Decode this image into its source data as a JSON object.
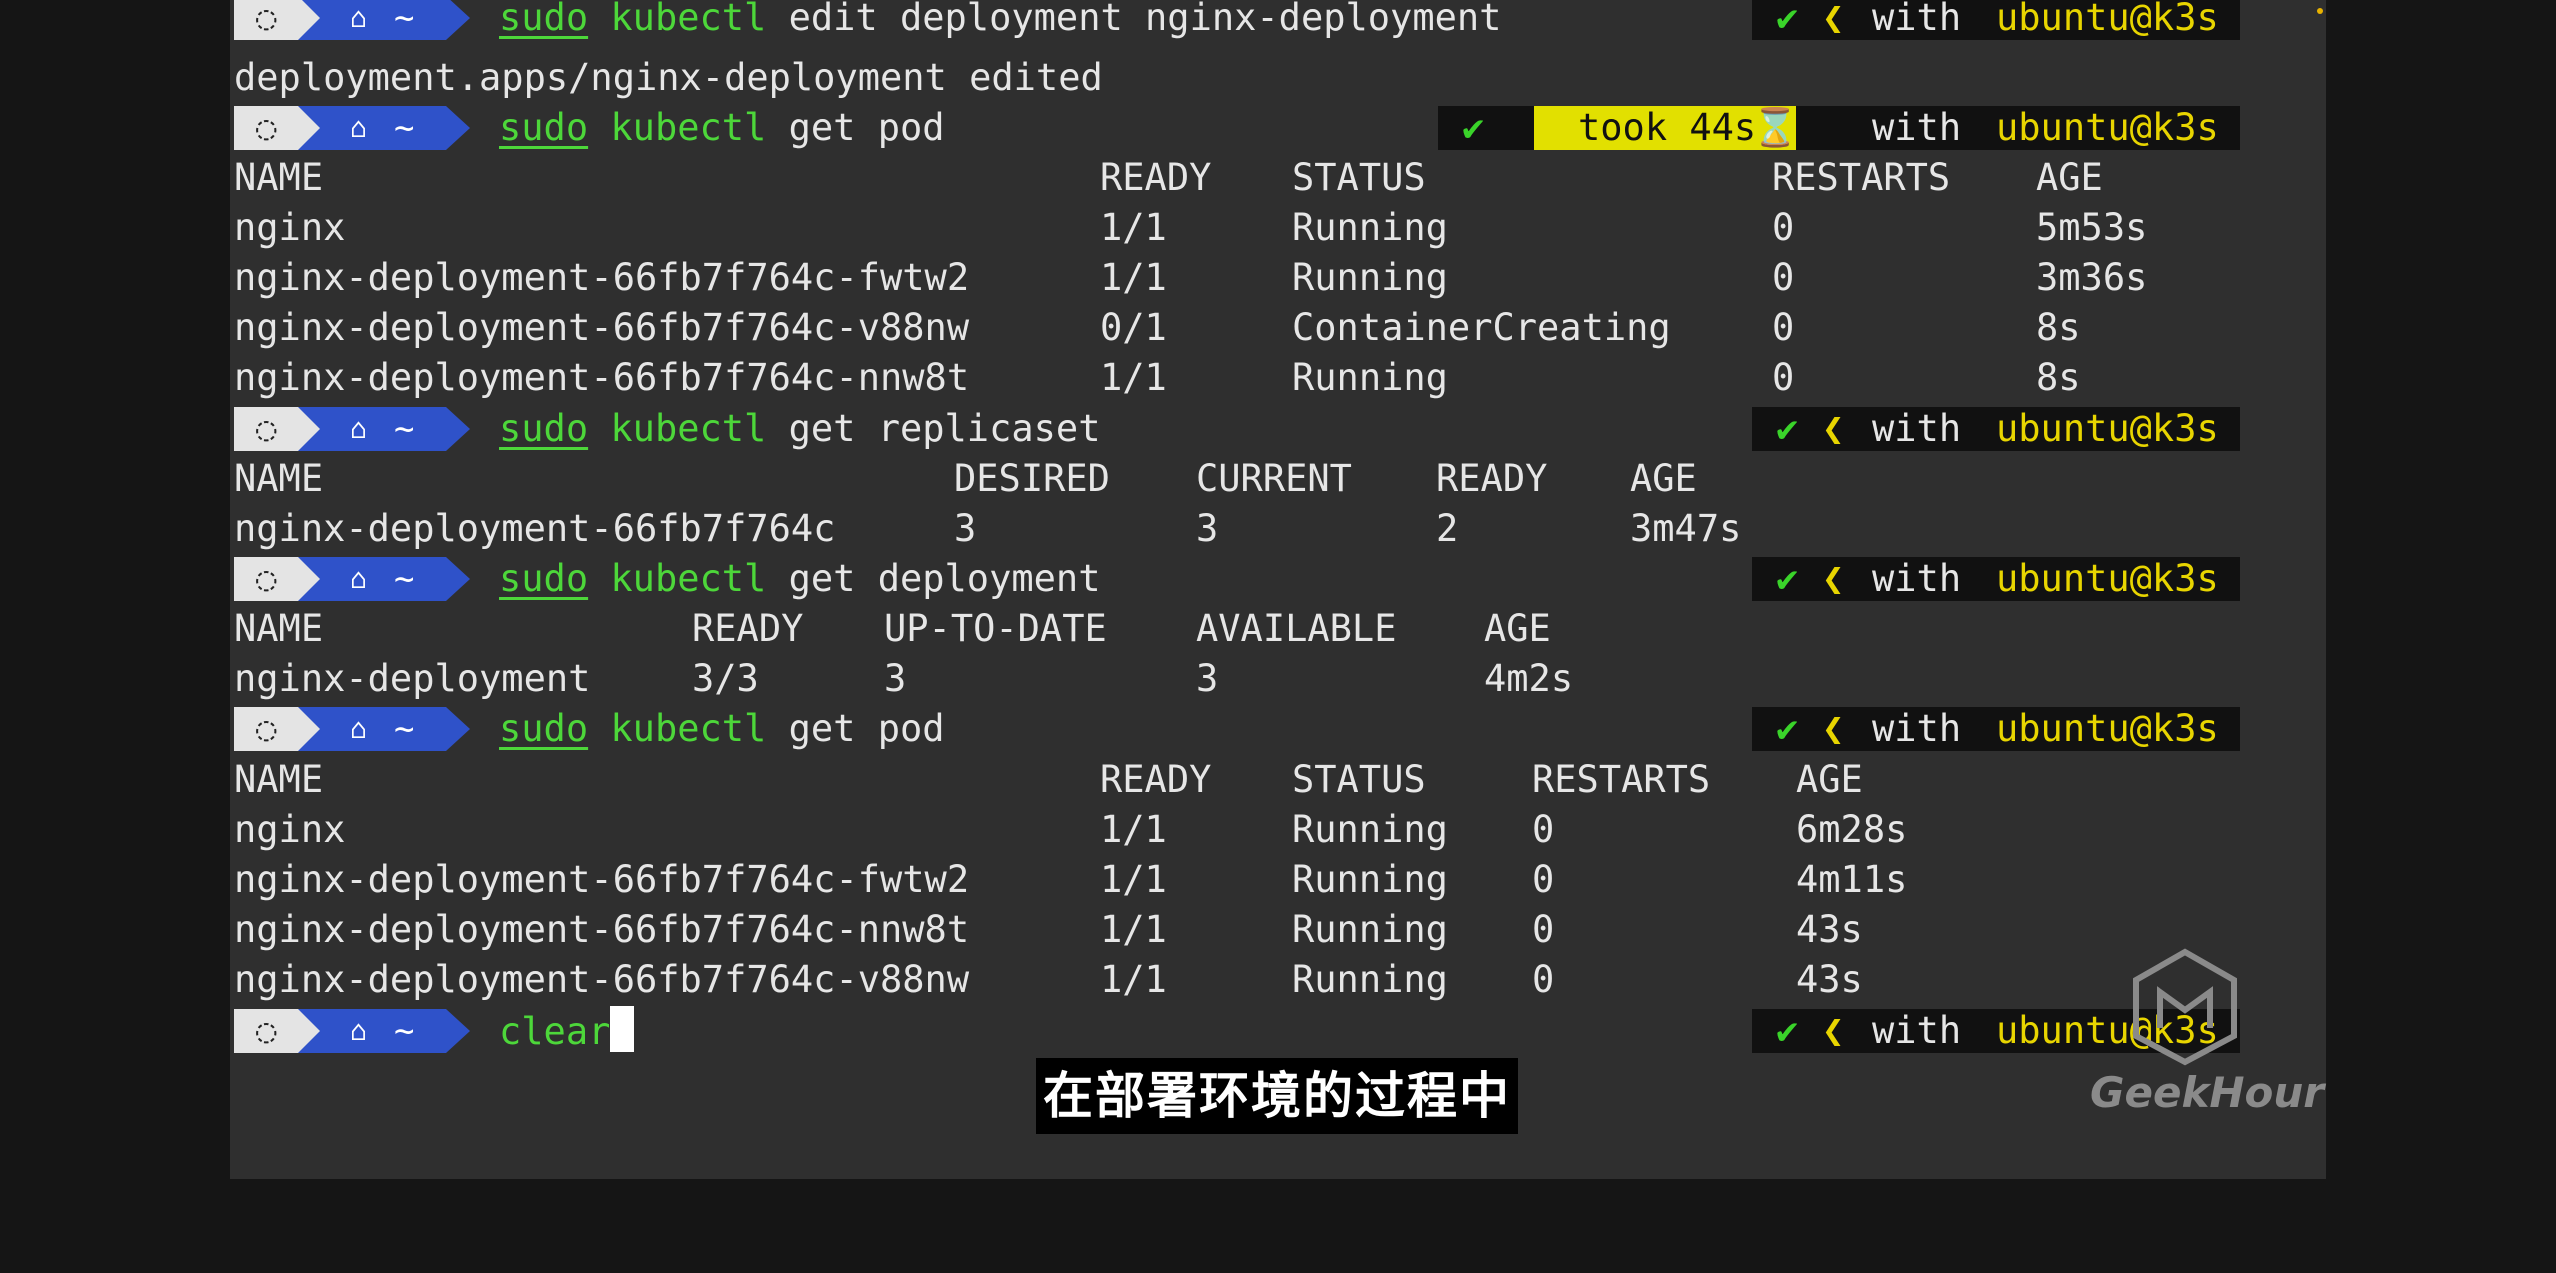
{
  "prompt": {
    "os_icon": "ubuntu-icon",
    "home_icon": "home-icon",
    "dir": "~"
  },
  "right_prompt": {
    "check": "✔",
    "sep": "❮",
    "with": "with",
    "userhost": "ubuntu@k3s",
    "took": "took 44s",
    "hourglass": "⌛"
  },
  "cmd1": {
    "sudo": "sudo",
    "kubectl": "kubectl",
    "rest": " edit deployment nginx-deployment"
  },
  "out1": "deployment.apps/nginx-deployment edited",
  "cmd2": {
    "sudo": "sudo",
    "kubectl": "kubectl",
    "rest": " get pod"
  },
  "pods1": {
    "headers": [
      "NAME",
      "READY",
      "STATUS",
      "RESTARTS",
      "AGE"
    ],
    "rows": [
      [
        "nginx",
        "1/1",
        "Running",
        "0",
        "5m53s"
      ],
      [
        "nginx-deployment-66fb7f764c-fwtw2",
        "1/1",
        "Running",
        "0",
        "3m36s"
      ],
      [
        "nginx-deployment-66fb7f764c-v88nw",
        "0/1",
        "ContainerCreating",
        "0",
        "8s"
      ],
      [
        "nginx-deployment-66fb7f764c-nnw8t",
        "1/1",
        "Running",
        "0",
        "8s"
      ]
    ]
  },
  "cmd3": {
    "sudo": "sudo",
    "kubectl": "kubectl",
    "rest": " get replicaset"
  },
  "rs": {
    "headers": [
      "NAME",
      "DESIRED",
      "CURRENT",
      "READY",
      "AGE"
    ],
    "rows": [
      [
        "nginx-deployment-66fb7f764c",
        "3",
        "3",
        "2",
        "3m47s"
      ]
    ]
  },
  "cmd4": {
    "sudo": "sudo",
    "kubectl": "kubectl",
    "rest": " get deployment"
  },
  "deploy": {
    "headers": [
      "NAME",
      "READY",
      "UP-TO-DATE",
      "AVAILABLE",
      "AGE"
    ],
    "rows": [
      [
        "nginx-deployment",
        "3/3",
        "3",
        "3",
        "4m2s"
      ]
    ]
  },
  "cmd5": {
    "sudo": "sudo",
    "kubectl": "kubectl",
    "rest": " get pod"
  },
  "pods2": {
    "headers": [
      "NAME",
      "READY",
      "STATUS",
      "RESTARTS",
      "AGE"
    ],
    "rows": [
      [
        "nginx",
        "1/1",
        "Running",
        "0",
        "6m28s"
      ],
      [
        "nginx-deployment-66fb7f764c-fwtw2",
        "1/1",
        "Running",
        "0",
        "4m11s"
      ],
      [
        "nginx-deployment-66fb7f764c-nnw8t",
        "1/1",
        "Running",
        "0",
        "43s"
      ],
      [
        "nginx-deployment-66fb7f764c-v88nw",
        "1/1",
        "Running",
        "0",
        "43s"
      ]
    ]
  },
  "cmd6": {
    "typed": "clear"
  },
  "subtitle": "在部署环境的过程中",
  "watermark": "GeekHour",
  "colors": {
    "terminal_bg": "#2f2f2f",
    "green": "#4dd73a",
    "yellow": "#e8d500",
    "blue_segment": "#2f52c9",
    "took_segment": "#e2e000"
  }
}
